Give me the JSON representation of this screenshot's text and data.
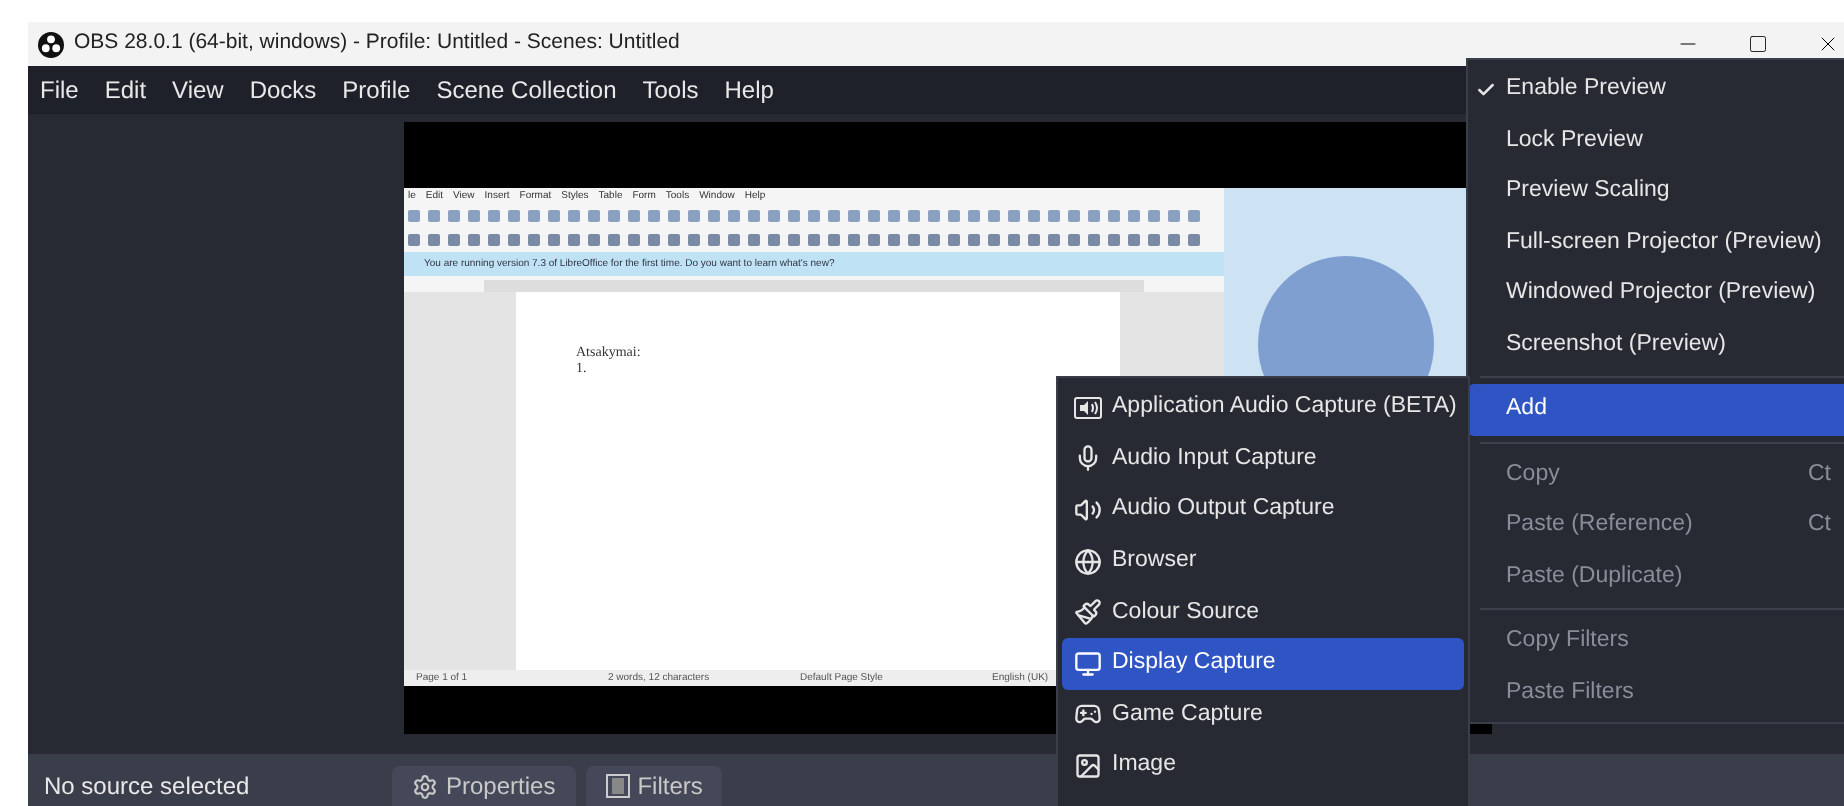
{
  "window": {
    "title": "OBS 28.0.1 (64-bit, windows) - Profile: Untitled - Scenes: Untitled"
  },
  "menu_bar": [
    "File",
    "Edit",
    "View",
    "Docks",
    "Profile",
    "Scene Collection",
    "Tools",
    "Help"
  ],
  "preview": {
    "document_window": {
      "menu_items": [
        "le",
        "Edit",
        "View",
        "Insert",
        "Format",
        "Styles",
        "Table",
        "Form",
        "Tools",
        "Window",
        "Help"
      ],
      "info_bar": "You are running version 7.3 of LibreOffice for the first time. Do you want to learn what's new?",
      "body_lines": [
        "Atsakymai:",
        "1."
      ],
      "status_fields": [
        "Page 1 of 1",
        "2 words, 12 characters",
        "Default Page Style",
        "English (UK)"
      ]
    }
  },
  "source_bar": {
    "status": "No source selected",
    "buttons": [
      "Properties",
      "Filters"
    ]
  },
  "context_menu": [
    {
      "kind": "item",
      "label": "Enable Preview",
      "checked": true,
      "selected": false,
      "disabled": false
    },
    {
      "kind": "item",
      "label": "Lock Preview",
      "checked": false,
      "selected": false,
      "disabled": false
    },
    {
      "kind": "item",
      "label": "Preview Scaling",
      "checked": false,
      "selected": false,
      "disabled": false
    },
    {
      "kind": "item",
      "label": "Full-screen Projector (Preview)",
      "checked": false,
      "selected": false,
      "disabled": false
    },
    {
      "kind": "item",
      "label": "Windowed Projector (Preview)",
      "checked": false,
      "selected": false,
      "disabled": false
    },
    {
      "kind": "item",
      "label": "Screenshot (Preview)",
      "checked": false,
      "selected": false,
      "disabled": false
    },
    {
      "kind": "separator"
    },
    {
      "kind": "item",
      "label": "Add",
      "checked": false,
      "selected": true,
      "disabled": false
    },
    {
      "kind": "separator"
    },
    {
      "kind": "item",
      "label": "Copy",
      "shortcut": "Ct",
      "checked": false,
      "selected": false,
      "disabled": true
    },
    {
      "kind": "item",
      "label": "Paste (Reference)",
      "shortcut": "Ct",
      "checked": false,
      "selected": false,
      "disabled": true
    },
    {
      "kind": "item",
      "label": "Paste (Duplicate)",
      "checked": false,
      "selected": false,
      "disabled": true
    },
    {
      "kind": "separator"
    },
    {
      "kind": "item",
      "label": "Copy Filters",
      "checked": false,
      "selected": false,
      "disabled": true
    },
    {
      "kind": "item",
      "label": "Paste Filters",
      "checked": false,
      "selected": false,
      "disabled": true
    }
  ],
  "add_submenu": [
    {
      "label": "Application Audio Capture (BETA)",
      "selected": false
    },
    {
      "label": "Audio Input Capture",
      "selected": false
    },
    {
      "label": "Audio Output Capture",
      "selected": false
    },
    {
      "label": "Browser",
      "selected": false
    },
    {
      "label": "Colour Source",
      "selected": false
    },
    {
      "label": "Display Capture",
      "selected": true
    },
    {
      "label": "Game Capture",
      "selected": false
    },
    {
      "label": "Image",
      "selected": false
    }
  ]
}
